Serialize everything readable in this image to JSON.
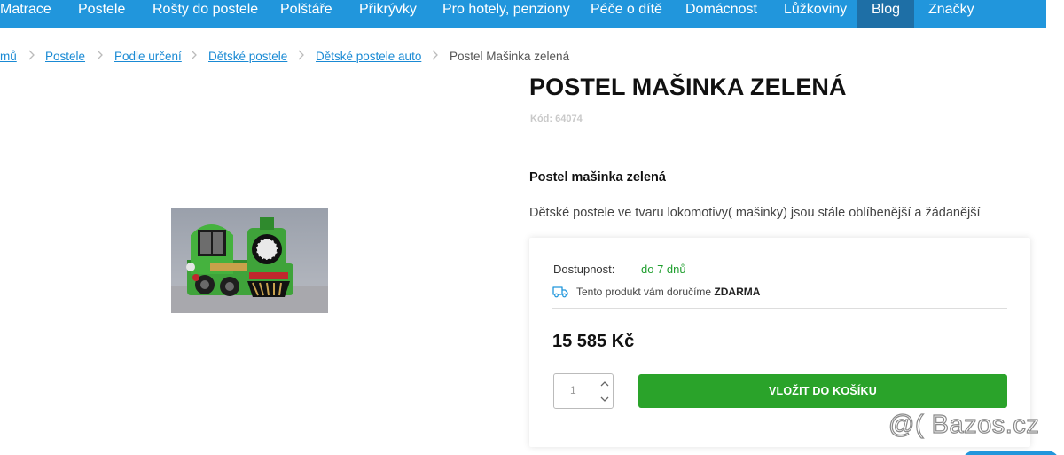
{
  "nav": {
    "items": [
      {
        "label": "Matrace"
      },
      {
        "label": "Postele"
      },
      {
        "label": "Rošty do postele"
      },
      {
        "label": "Polštáře"
      },
      {
        "label": "Přikrývky"
      },
      {
        "label": "Pro hotely, penziony"
      },
      {
        "label": "Péče o dítě"
      },
      {
        "label": "Domácnost"
      },
      {
        "label": "Lůžkoviny"
      },
      {
        "label": "Blog"
      },
      {
        "label": "Značky"
      }
    ],
    "active": "Blog"
  },
  "breadcrumb": {
    "items": [
      "mů",
      "Postele",
      "Podle určení",
      "Dětské postele",
      "Dětské postele auto"
    ],
    "current": "Postel Mašinka zelená"
  },
  "product": {
    "title": "POSTEL MAŠINKA ZELENÁ",
    "code": "Kód: 64074",
    "subtitle": "Postel mašinka zelená",
    "description": "Dětské postele ve tvaru lokomotivy( mašinky) jsou stále oblíbenější a žádanější",
    "image_alt": "green locomotive bed"
  },
  "purchase": {
    "availability_label": "Dostupnost:",
    "availability_value": "do 7 dnů",
    "delivery_text": "Tento produkt vám doručíme ",
    "delivery_strong": "ZDARMA",
    "price": "15 585 Kč",
    "quantity": "1",
    "add_to_cart": "VLOŽIT DO KOŠÍKU"
  },
  "colors": {
    "nav_bg": "#2196dc",
    "nav_active": "#1e6fa6",
    "link": "#1a8ad4",
    "availability": "#1f9e2e",
    "button": "#2aa32a"
  },
  "watermark": "@( Bazos.cz"
}
